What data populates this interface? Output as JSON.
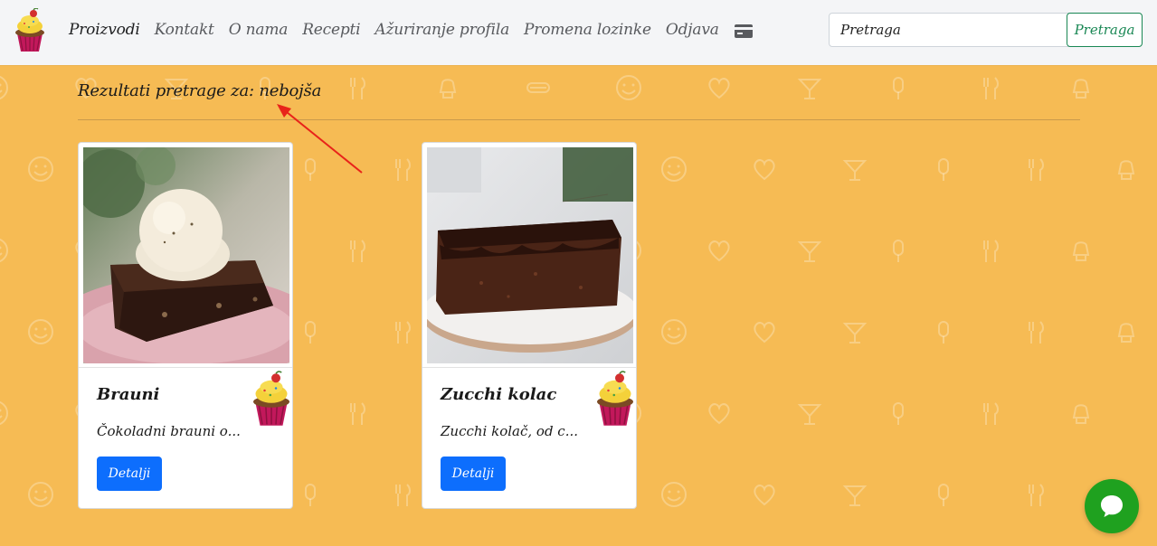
{
  "navbar": {
    "links": [
      {
        "label": "Proizvodi",
        "active": true
      },
      {
        "label": "Kontakt",
        "active": false
      },
      {
        "label": "O nama",
        "active": false
      },
      {
        "label": "Recepti",
        "active": false
      },
      {
        "label": "Ažuriranje profila",
        "active": false
      },
      {
        "label": "Promena lozinke",
        "active": false
      },
      {
        "label": "Odjava",
        "active": false
      }
    ],
    "cart_icon": "credit-card-icon",
    "search": {
      "value": "Pretraga",
      "placeholder": "Pretraga",
      "button_label": "Pretraga"
    }
  },
  "results": {
    "heading": "Rezultati pretrage za: nebojša"
  },
  "products": [
    {
      "name": "Brauni",
      "description": "Čokoladni brauni o...",
      "button_label": "Detalji",
      "image": "brownie-with-ice-cream"
    },
    {
      "name": "Zucchi kolac",
      "description": "Zucchi kolač, od c...",
      "button_label": "Detalji",
      "image": "chocolate-zucchini-cake"
    }
  ],
  "colors": {
    "background": "#f6bb54",
    "navbar": "#f4f5f7",
    "search_button": "#198754",
    "details_button": "#0d6efd",
    "chat_button": "#1fa11f",
    "annotation_arrow": "#e8231a"
  },
  "chat": {
    "icon": "chat-bubble-icon"
  }
}
